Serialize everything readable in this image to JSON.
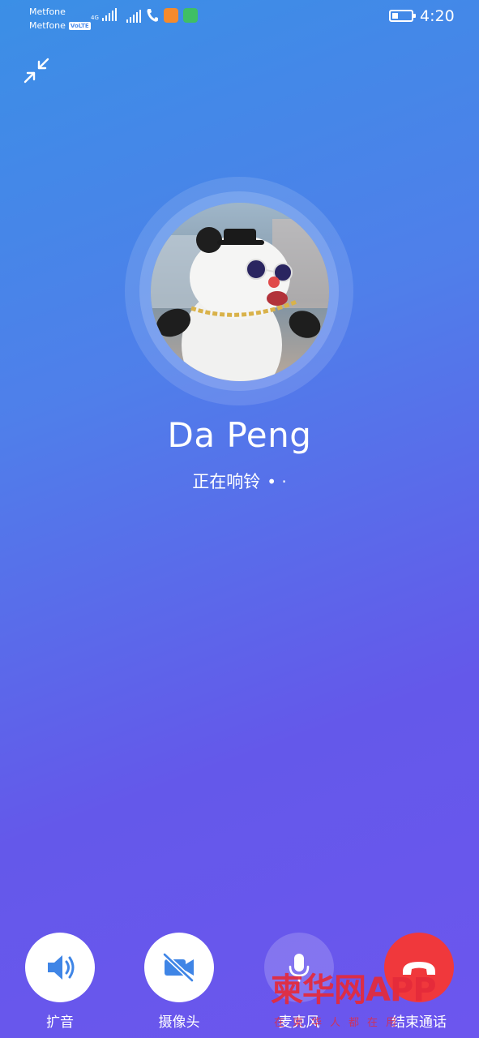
{
  "status_bar": {
    "carrier_1": "Metfone",
    "carrier_2": "Metfone",
    "volte_badge": "VoLTE",
    "network_type": "4G",
    "time": "4:20"
  },
  "caller": {
    "name": "Da Peng",
    "status": "正在响铃",
    "status_dots": "• ·"
  },
  "controls": [
    {
      "label": "扩音",
      "icon": "speaker-icon"
    },
    {
      "label": "摄像头",
      "icon": "camera-off-icon"
    },
    {
      "label": "麦克风",
      "icon": "microphone-icon"
    },
    {
      "label": "结束通话",
      "icon": "end-call-icon"
    }
  ],
  "watermark": {
    "main": "柬华网APP",
    "sub": "在柬华人都在用"
  },
  "colors": {
    "end_call": "#f0383c",
    "watermark": "#e52a3a",
    "icon_blue": "#3f85e6"
  }
}
